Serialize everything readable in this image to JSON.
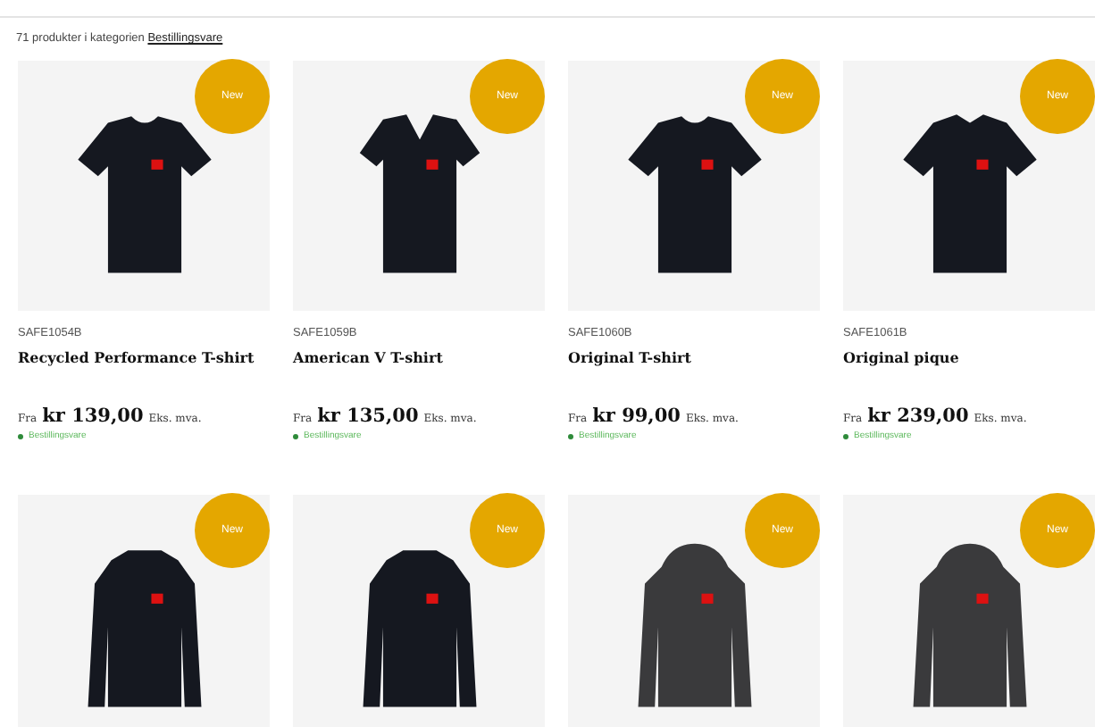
{
  "summary": {
    "text": "71 produkter i kategorien",
    "link": "Bestillingsvare"
  },
  "products": [
    {
      "kind": "tshirt",
      "badge": "New",
      "code": "SAFE1054B",
      "title": "Recycled Performance T-shirt",
      "price_prefix": "Fra",
      "price": "kr 139,00",
      "price_suffix": "Eks. mva.",
      "stock": "Bestillingsvare"
    },
    {
      "kind": "vneck",
      "badge": "New",
      "code": "SAFE1059B",
      "title": "American V T-shirt",
      "price_prefix": "Fra",
      "price": "kr 135,00",
      "price_suffix": "Eks. mva.",
      "stock": "Bestillingsvare"
    },
    {
      "kind": "tshirt",
      "badge": "New",
      "code": "SAFE1060B",
      "title": "Original T-shirt",
      "price_prefix": "Fra",
      "price": "kr 99,00",
      "price_suffix": "Eks. mva.",
      "stock": "Bestillingsvare"
    },
    {
      "kind": "polo",
      "badge": "New",
      "code": "SAFE1061B",
      "title": "Original pique",
      "price_prefix": "Fra",
      "price": "kr 239,00",
      "price_suffix": "Eks. mva.",
      "stock": "Bestillingsvare"
    },
    {
      "kind": "jacket",
      "badge": "New"
    },
    {
      "kind": "jacket",
      "badge": "New"
    },
    {
      "kind": "hoodie",
      "badge": "New"
    },
    {
      "kind": "hoodie",
      "badge": "New"
    }
  ]
}
